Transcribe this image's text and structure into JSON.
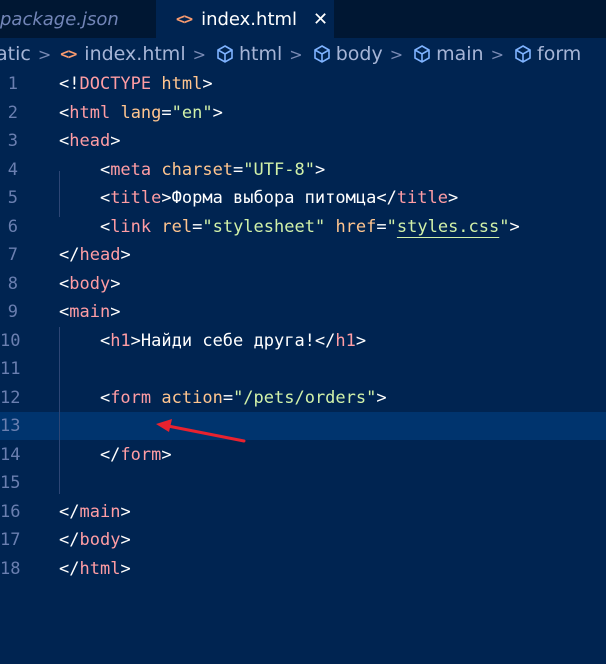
{
  "tabs": [
    {
      "label": "package.json",
      "active": false
    },
    {
      "label": "index.html",
      "active": true,
      "icon": "html-brackets-icon",
      "close": "✕"
    }
  ],
  "breadcrumb": [
    {
      "label": "atic",
      "icon": null
    },
    {
      "label": "index.html",
      "icon": "html-brackets-icon"
    },
    {
      "label": "html",
      "icon": "cube-icon"
    },
    {
      "label": "body",
      "icon": "cube-icon"
    },
    {
      "label": "main",
      "icon": "cube-icon"
    },
    {
      "label": "form",
      "icon": "cube-icon"
    }
  ],
  "editor": {
    "current_line": 13,
    "lines": [
      {
        "n": "1",
        "tokens": [
          [
            "punct",
            "<!"
          ],
          [
            "tag",
            "DOCTYPE"
          ],
          [
            "punct",
            " "
          ],
          [
            "attr",
            "html"
          ],
          [
            "punct",
            ">"
          ]
        ]
      },
      {
        "n": "2",
        "tokens": [
          [
            "punct",
            "<"
          ],
          [
            "tag",
            "html"
          ],
          [
            "punct",
            " "
          ],
          [
            "attr",
            "lang"
          ],
          [
            "punct",
            "="
          ],
          [
            "str",
            "\"en\""
          ],
          [
            "punct",
            ">"
          ]
        ]
      },
      {
        "n": "3",
        "tokens": [
          [
            "punct",
            "<"
          ],
          [
            "tag",
            "head"
          ],
          [
            "punct",
            ">"
          ]
        ]
      },
      {
        "n": "4",
        "tokens": [
          [
            "punct",
            "    <"
          ],
          [
            "tag",
            "meta"
          ],
          [
            "punct",
            " "
          ],
          [
            "attr",
            "charset"
          ],
          [
            "punct",
            "="
          ],
          [
            "str",
            "\"UTF-8\""
          ],
          [
            "punct",
            ">"
          ]
        ]
      },
      {
        "n": "5",
        "tokens": [
          [
            "punct",
            "    <"
          ],
          [
            "tag",
            "title"
          ],
          [
            "punct",
            ">"
          ],
          [
            "txt",
            "Форма выбора питомца"
          ],
          [
            "punct",
            "</"
          ],
          [
            "tag",
            "title"
          ],
          [
            "punct",
            ">"
          ]
        ]
      },
      {
        "n": "6",
        "tokens": [
          [
            "punct",
            "    <"
          ],
          [
            "tag",
            "link"
          ],
          [
            "punct",
            " "
          ],
          [
            "attr",
            "rel"
          ],
          [
            "punct",
            "="
          ],
          [
            "str",
            "\"stylesheet\""
          ],
          [
            "punct",
            " "
          ],
          [
            "attr",
            "href"
          ],
          [
            "punct",
            "="
          ],
          [
            "str",
            "\""
          ],
          [
            "str link-underline",
            "styles.css"
          ],
          [
            "str",
            "\""
          ],
          [
            "punct",
            ">"
          ]
        ]
      },
      {
        "n": "7",
        "tokens": [
          [
            "punct",
            "</"
          ],
          [
            "tag",
            "head"
          ],
          [
            "punct",
            ">"
          ]
        ]
      },
      {
        "n": "8",
        "tokens": [
          [
            "punct",
            "<"
          ],
          [
            "tag",
            "body"
          ],
          [
            "punct",
            ">"
          ]
        ]
      },
      {
        "n": "9",
        "tokens": [
          [
            "punct",
            "<"
          ],
          [
            "tag",
            "main"
          ],
          [
            "punct",
            ">"
          ]
        ]
      },
      {
        "n": "10",
        "tokens": [
          [
            "punct",
            "    <"
          ],
          [
            "tag",
            "h1"
          ],
          [
            "punct",
            ">"
          ],
          [
            "txt",
            "Найди себе друга!"
          ],
          [
            "punct",
            "</"
          ],
          [
            "tag",
            "h1"
          ],
          [
            "punct",
            ">"
          ]
        ]
      },
      {
        "n": "11",
        "tokens": []
      },
      {
        "n": "12",
        "tokens": [
          [
            "punct",
            "    <"
          ],
          [
            "tag",
            "form"
          ],
          [
            "punct",
            " "
          ],
          [
            "attr",
            "action"
          ],
          [
            "punct",
            "="
          ],
          [
            "str",
            "\"/pets/orders\""
          ],
          [
            "punct",
            ">"
          ]
        ]
      },
      {
        "n": "13",
        "tokens": []
      },
      {
        "n": "14",
        "tokens": [
          [
            "punct",
            "    </"
          ],
          [
            "tag",
            "form"
          ],
          [
            "punct",
            ">"
          ]
        ]
      },
      {
        "n": "15",
        "tokens": []
      },
      {
        "n": "16",
        "tokens": [
          [
            "punct",
            "</"
          ],
          [
            "tag",
            "main"
          ],
          [
            "punct",
            ">"
          ]
        ]
      },
      {
        "n": "17",
        "tokens": [
          [
            "punct",
            "</"
          ],
          [
            "tag",
            "body"
          ],
          [
            "punct",
            ">"
          ]
        ]
      },
      {
        "n": "18",
        "tokens": [
          [
            "punct",
            "</"
          ],
          [
            "tag",
            "html"
          ],
          [
            "punct",
            ">"
          ]
        ]
      }
    ]
  },
  "colors": {
    "background": "#002451",
    "tab_bar": "#001733",
    "current_line": "#00346e",
    "tag": "#ff9da4",
    "attribute": "#ffc58f",
    "string": "#d1f1a9",
    "annotation_arrow": "#e8222f"
  }
}
